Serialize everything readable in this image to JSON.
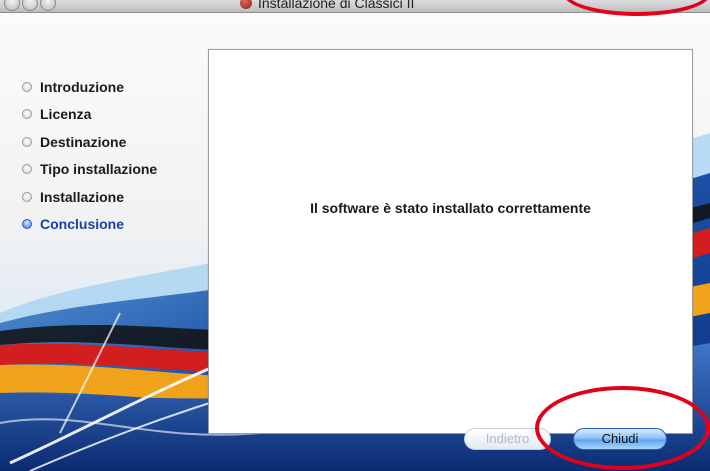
{
  "window": {
    "title": "Installazione di Classici II",
    "traffic_lights": [
      "close-button",
      "minimize-button",
      "zoom-button"
    ]
  },
  "sidebar": {
    "steps": [
      {
        "label": "Introduzione",
        "active": false
      },
      {
        "label": "Licenza",
        "active": false
      },
      {
        "label": "Destinazione",
        "active": false
      },
      {
        "label": "Tipo installazione",
        "active": false
      },
      {
        "label": "Installazione",
        "active": false
      },
      {
        "label": "Conclusione",
        "active": true
      }
    ]
  },
  "main": {
    "message": "Il software è stato installato correttamente"
  },
  "buttons": {
    "back_label": "Indietro",
    "close_label": "Chiudi"
  },
  "colors": {
    "active_step": "#1a3fa8",
    "annotation": "#e3001b",
    "primary_button": "#5ea6ee"
  }
}
